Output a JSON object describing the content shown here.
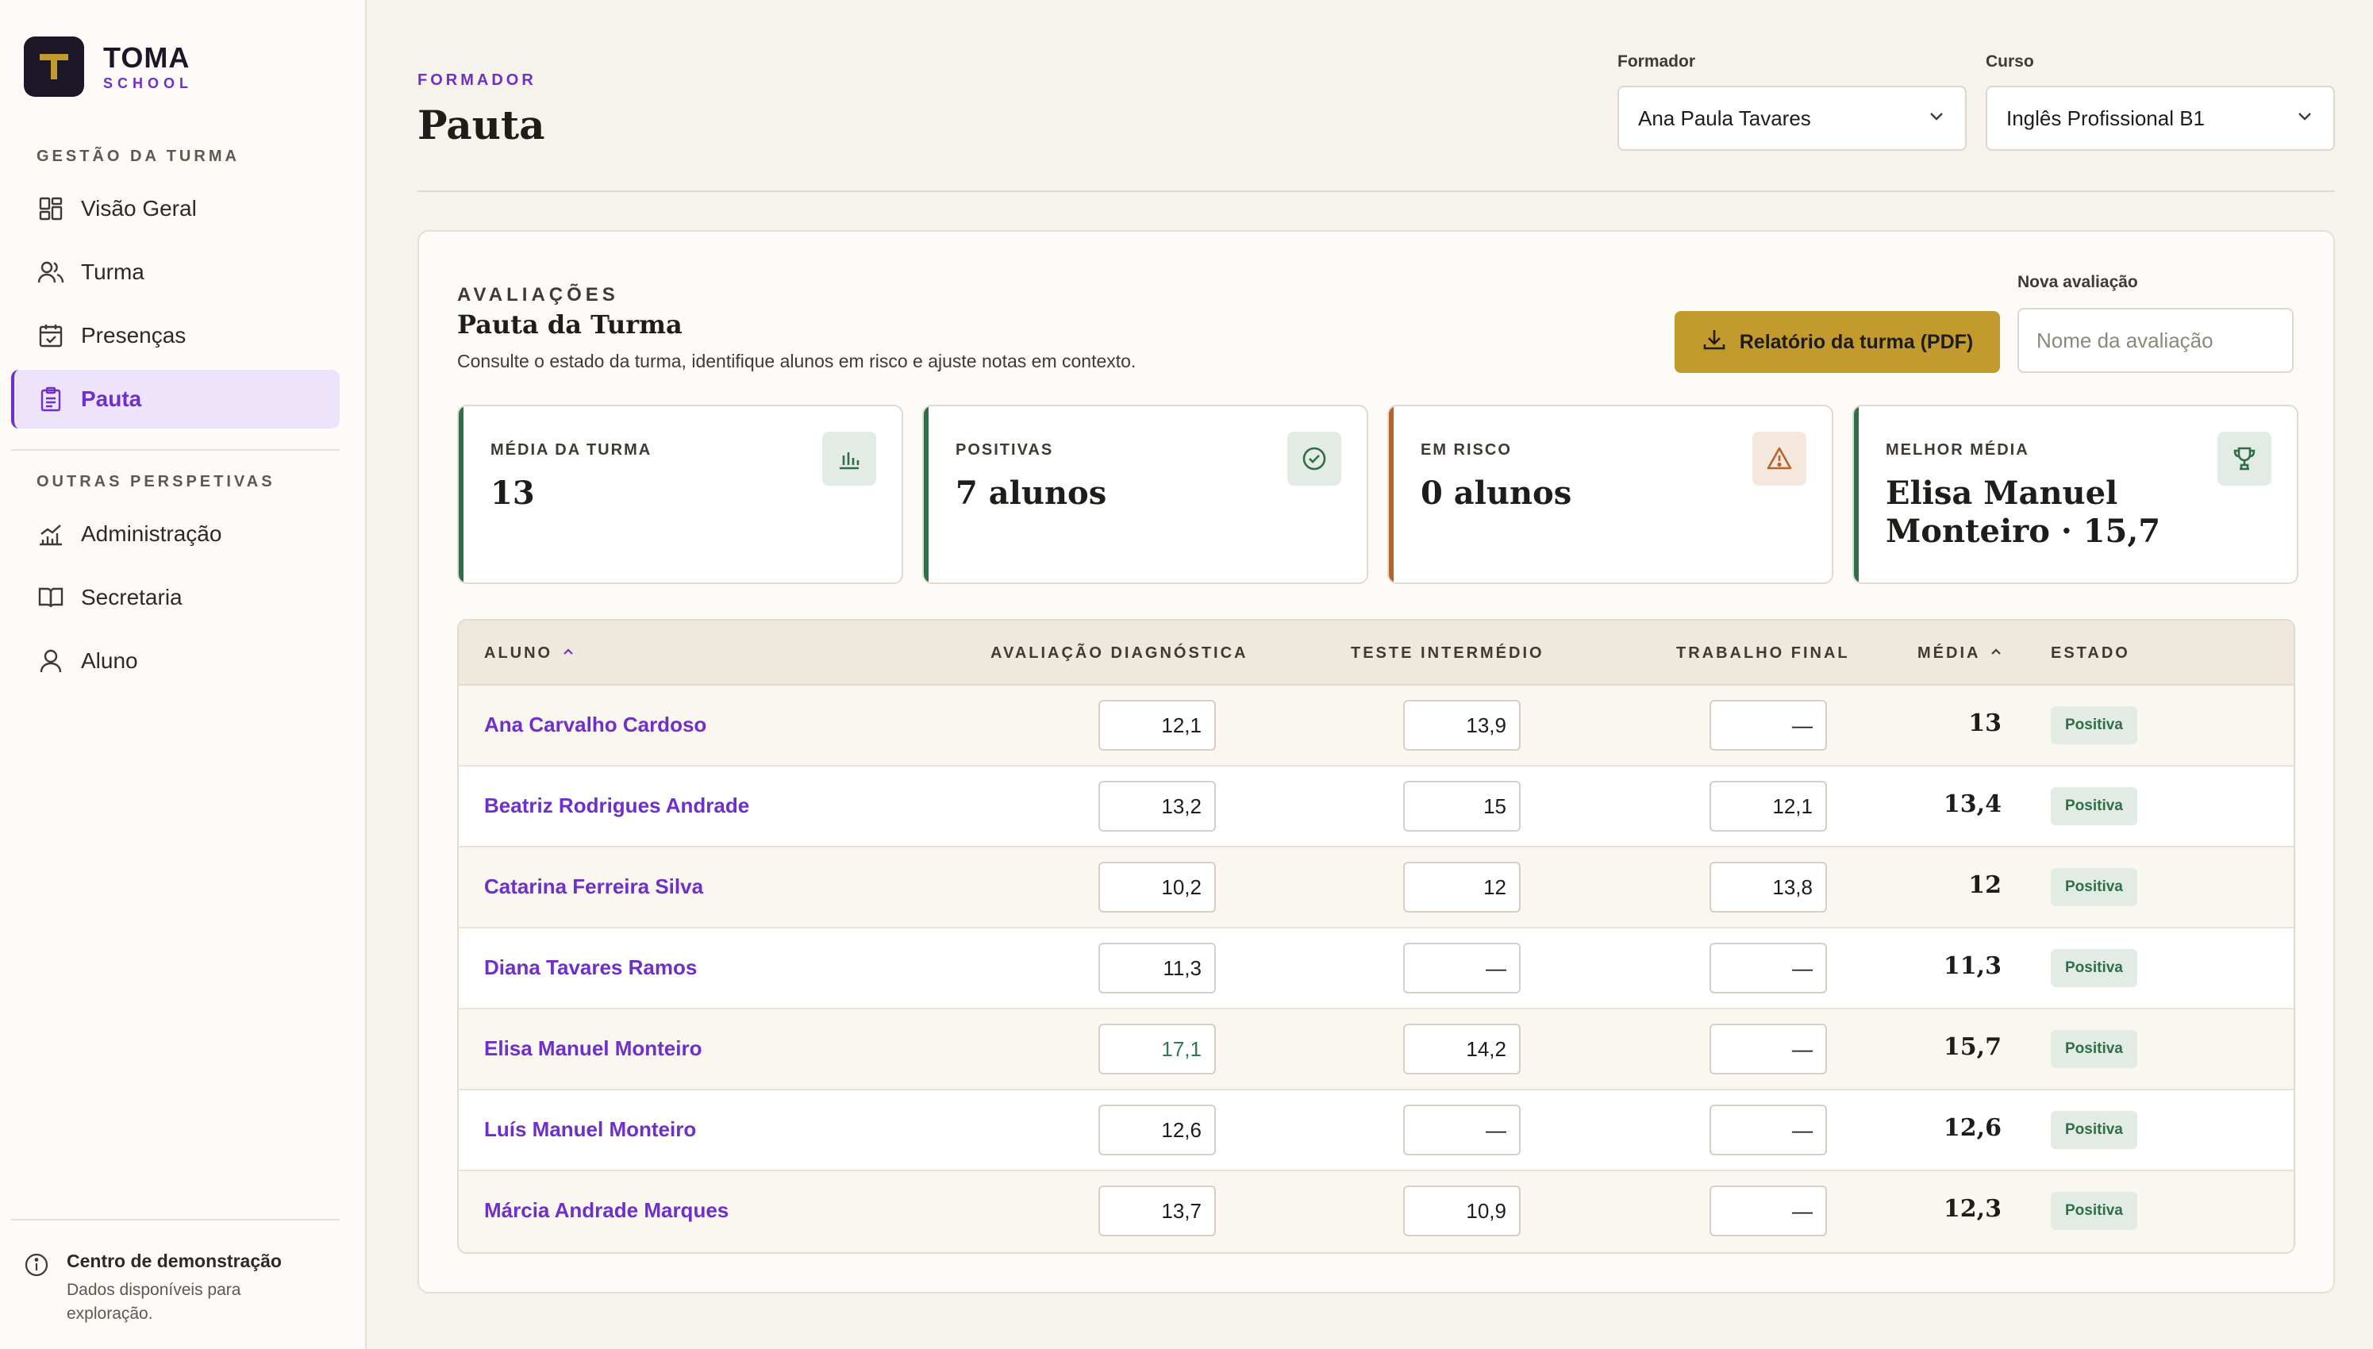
{
  "brand": {
    "name": "TOMA",
    "sub": "SCHOOL",
    "logo_letter": "T"
  },
  "sidebar": {
    "section1": "GESTÃO DA TURMA",
    "items1": [
      {
        "label": "Visão Geral",
        "icon": "grid-icon"
      },
      {
        "label": "Turma",
        "icon": "users-icon"
      },
      {
        "label": "Presenças",
        "icon": "calendar-check-icon"
      },
      {
        "label": "Pauta",
        "icon": "clipboard-icon",
        "active": true
      }
    ],
    "section2": "OUTRAS PERSPETIVAS",
    "items2": [
      {
        "label": "Administração",
        "icon": "bar-chart-icon"
      },
      {
        "label": "Secretaria",
        "icon": "book-icon"
      },
      {
        "label": "Aluno",
        "icon": "user-icon"
      }
    ],
    "demo_title": "Centro de demonstração",
    "demo_sub": "Dados disponíveis para exploração."
  },
  "header": {
    "eyebrow": "FORMADOR",
    "title": "Pauta",
    "formador_label": "Formador",
    "formador_value": "Ana Paula Tavares",
    "curso_label": "Curso",
    "curso_value": "Inglês Profissional B1"
  },
  "card": {
    "eyebrow": "AVALIAÇÕES",
    "title": "Pauta da Turma",
    "desc": "Consulte o estado da turma, identifique alunos em risco e ajuste notas em contexto.",
    "pdf_label": "Relatório da turma (PDF)",
    "new_label": "Nova avaliação",
    "new_placeholder": "Nome da avaliação"
  },
  "stats": [
    {
      "label": "MÉDIA DA TURMA",
      "value": "13",
      "icon": "bar-chart-icon",
      "color": "#2f6e47"
    },
    {
      "label": "POSITIVAS",
      "value": "7 alunos",
      "icon": "check-circle-icon",
      "color": "#2f6e47"
    },
    {
      "label": "EM RISCO",
      "value": "0 alunos",
      "icon": "alert-triangle-icon",
      "color": "#b5652c"
    },
    {
      "label": "MELHOR MÉDIA",
      "value": "Elisa Manuel Monteiro · 15,7",
      "icon": "trophy-icon",
      "color": "#2f6e47"
    }
  ],
  "table": {
    "headers": {
      "aluno": "ALUNO",
      "diag": "AVALIAÇÃO DIAGNÓSTICA",
      "inter": "TESTE INTERMÉDIO",
      "final": "TRABALHO FINAL",
      "media": "MÉDIA",
      "estado": "ESTADO"
    },
    "rows": [
      {
        "name": "Ana Carvalho Cardoso",
        "diag": "12,1",
        "inter": "13,9",
        "final": "—",
        "media": "13",
        "estado": "Positiva"
      },
      {
        "name": "Beatriz Rodrigues Andrade",
        "diag": "13,2",
        "inter": "15",
        "final": "12,1",
        "media": "13,4",
        "estado": "Positiva"
      },
      {
        "name": "Catarina Ferreira Silva",
        "diag": "10,2",
        "inter": "12",
        "final": "13,8",
        "media": "12",
        "estado": "Positiva"
      },
      {
        "name": "Diana Tavares Ramos",
        "diag": "11,3",
        "inter": "—",
        "final": "—",
        "media": "11,3",
        "estado": "Positiva"
      },
      {
        "name": "Elisa Manuel Monteiro",
        "diag": "17,1",
        "inter": "14,2",
        "final": "—",
        "media": "15,7",
        "estado": "Positiva"
      },
      {
        "name": "Luís Manuel Monteiro",
        "diag": "12,6",
        "inter": "—",
        "final": "—",
        "media": "12,6",
        "estado": "Positiva"
      },
      {
        "name": "Márcia Andrade Marques",
        "diag": "13,7",
        "inter": "10,9",
        "final": "—",
        "media": "12,3",
        "estado": "Positiva"
      }
    ]
  }
}
